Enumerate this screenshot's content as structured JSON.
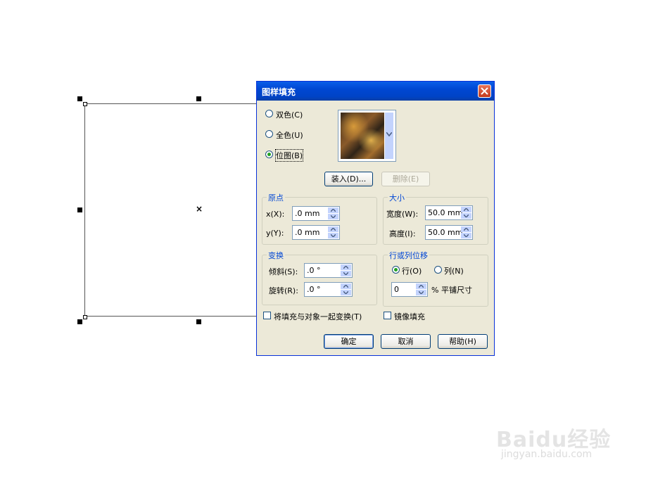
{
  "dialog": {
    "title": "图样填充",
    "mode_options": [
      {
        "label": "双色(C)",
        "selected": false
      },
      {
        "label": "全色(U)",
        "selected": false
      },
      {
        "label": "位图(B)",
        "selected": true
      }
    ],
    "load_button": "装入(D)...",
    "delete_button": "删除(E)",
    "origin": {
      "title": "原点",
      "x_label": "x(X):",
      "x_value": ".0 mm",
      "y_label": "y(Y):",
      "y_value": ".0 mm"
    },
    "size": {
      "title": "大小",
      "width_label": "宽度(W):",
      "width_value": "50.0 mm",
      "height_label": "高度(I):",
      "height_value": "50.0 mm"
    },
    "transform": {
      "title": "变换",
      "skew_label": "倾斜(S):",
      "skew_value": ".0 °",
      "rotate_label": "旋转(R):",
      "rotate_value": ".0 °"
    },
    "offset": {
      "title": "行或列位移",
      "row_label": "行(O)",
      "row_selected": true,
      "col_label": "列(N)",
      "col_selected": false,
      "value": "0",
      "unit_label": "% 平铺尺寸"
    },
    "transform_with_object_label": "将填充与对象一起变换(T)",
    "mirror_fill_label": "镜像填充",
    "ok_button": "确定",
    "cancel_button": "取消",
    "help_button": "帮助(H)"
  },
  "watermark": {
    "brand": "Baidu经验",
    "url": "jingyan.baidu.com"
  },
  "colors": {
    "title_bar": "#0054e3",
    "group_title": "#0046d5",
    "face": "#ece9d8"
  }
}
